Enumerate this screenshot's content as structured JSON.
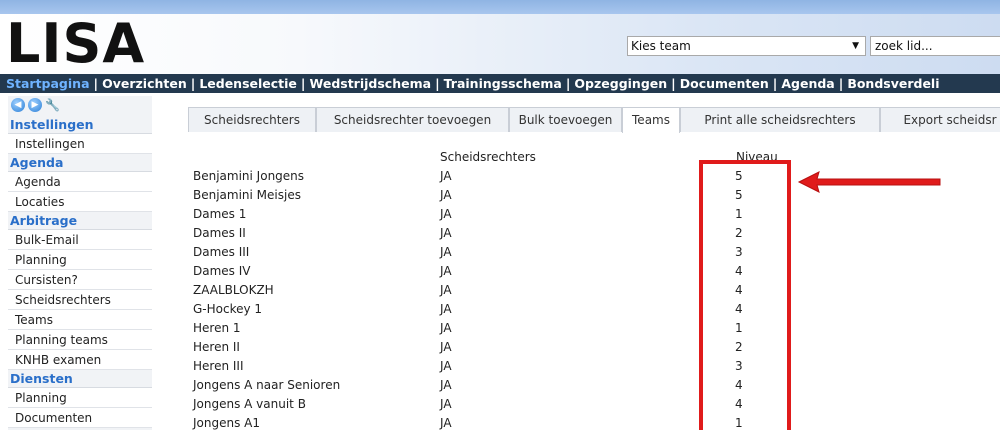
{
  "app": {
    "logo": "LISA"
  },
  "header": {
    "team_select": "Kies team",
    "search_placeholder": "zoek lid..."
  },
  "nav": {
    "items": [
      "Startpagina",
      "Overzichten",
      "Ledenselectie",
      "Wedstrijdschema",
      "Trainingsschema",
      "Opzeggingen",
      "Documenten",
      "Agenda",
      "Bondsverdeli"
    ],
    "separator": "|",
    "active_color": "#6fb3ff"
  },
  "sidebar": {
    "icons": [
      "back-icon",
      "forward-icon",
      "wrench-icon"
    ],
    "sections": [
      {
        "title": "Instellingen",
        "items": [
          "Instellingen"
        ]
      },
      {
        "title": "Agenda",
        "items": [
          "Agenda",
          "Locaties"
        ]
      },
      {
        "title": "Arbitrage",
        "items": [
          "Bulk-Email",
          "Planning",
          "Cursisten?",
          "Scheidsrechters",
          "Teams",
          "Planning teams",
          "KNHB examen"
        ]
      },
      {
        "title": "Diensten",
        "items": [
          "Planning",
          "Documenten"
        ]
      }
    ]
  },
  "tabs": [
    "Scheidsrechters",
    "Scheidsrechter toevoegen",
    "Bulk toevoegen",
    "Teams",
    "Print alle scheidsrechters",
    "Export scheidsr"
  ],
  "active_tab": "Teams",
  "table": {
    "headers": {
      "team": "",
      "scheidsrechters": "Scheidsrechters",
      "niveau": "Niveau"
    },
    "rows": [
      {
        "team": "Benjamini Jongens",
        "ref": "JA",
        "level": "5"
      },
      {
        "team": "Benjamini Meisjes",
        "ref": "JA",
        "level": "5"
      },
      {
        "team": "Dames 1",
        "ref": "JA",
        "level": "1"
      },
      {
        "team": "Dames II",
        "ref": "JA",
        "level": "2"
      },
      {
        "team": "Dames III",
        "ref": "JA",
        "level": "3"
      },
      {
        "team": "Dames IV",
        "ref": "JA",
        "level": "4"
      },
      {
        "team": "ZAALBLOKZH",
        "ref": "JA",
        "level": "4"
      },
      {
        "team": "G-Hockey 1",
        "ref": "JA",
        "level": "4"
      },
      {
        "team": "Heren 1",
        "ref": "JA",
        "level": "1"
      },
      {
        "team": "Heren II",
        "ref": "JA",
        "level": "2"
      },
      {
        "team": "Heren III",
        "ref": "JA",
        "level": "3"
      },
      {
        "team": "Jongens A naar Senioren",
        "ref": "JA",
        "level": "4"
      },
      {
        "team": "Jongens A vanuit B",
        "ref": "JA",
        "level": "4"
      },
      {
        "team": "Jongens A1",
        "ref": "JA",
        "level": "1"
      }
    ]
  },
  "annotation": {
    "color": "#e01b1b"
  }
}
